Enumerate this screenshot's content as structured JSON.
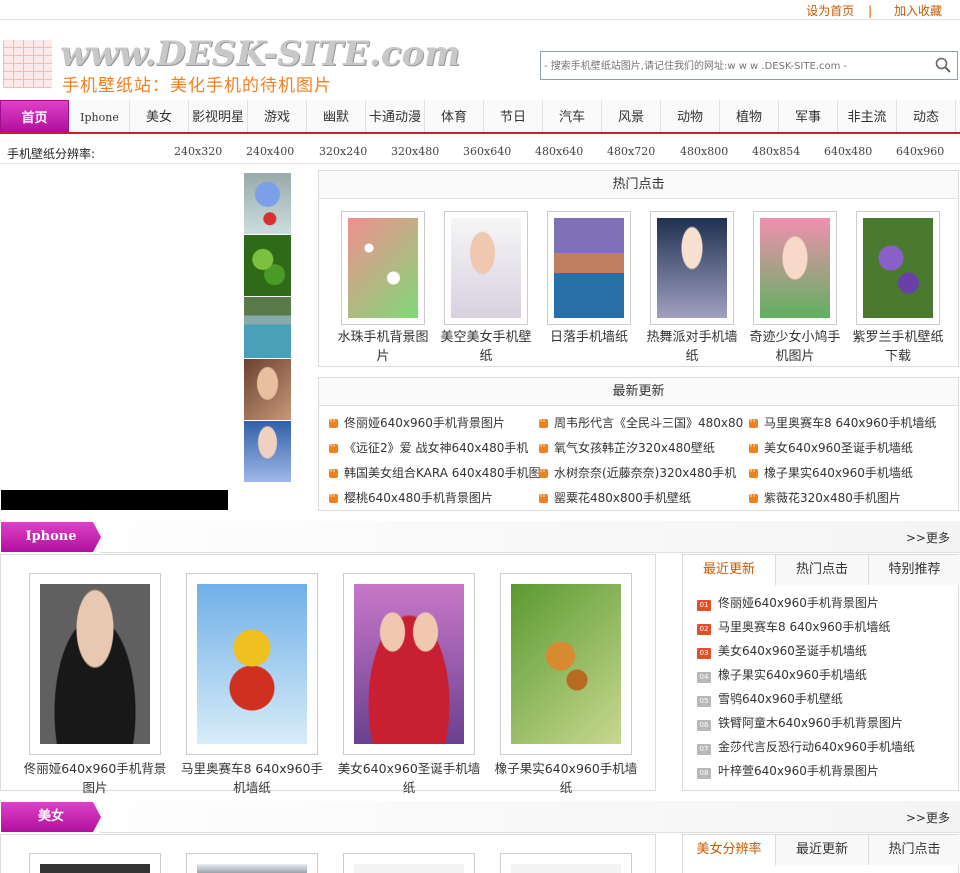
{
  "topbar": {
    "set_home": "设为首页",
    "separator": "|",
    "bookmark": "加入收藏"
  },
  "header": {
    "logo_text": "www.DESK-SITE.com",
    "logo_subtitle": "手机壁纸站：美化手机的待机图片",
    "search_placeholder": "- 搜索手机壁纸站图片,请记住我们的网址:w w w .DESK-SITE.com -"
  },
  "nav": [
    "首页",
    "Iphone",
    "美女",
    "影视明星",
    "游戏",
    "幽默",
    "卡通动漫",
    "体育",
    "节日",
    "汽车",
    "风景",
    "动物",
    "植物",
    "军事",
    "非主流",
    "动态"
  ],
  "resolution": {
    "label": "手机壁纸分辨率:",
    "items": [
      "240x320",
      "240x400",
      "320x240",
      "320x480",
      "360x640",
      "480x640",
      "480x720",
      "480x800",
      "480x854",
      "640x480",
      "640x960"
    ]
  },
  "hot": {
    "title": "热门点击",
    "items": [
      {
        "line1": "水珠手机背景图",
        "line2": "片"
      },
      {
        "line1": "美空美女手机壁",
        "line2": "纸"
      },
      {
        "line1": "日落手机墙纸",
        "line2": ""
      },
      {
        "line1": "热舞派对手机墙",
        "line2": "纸"
      },
      {
        "line1": "奇迹少女小鸠手",
        "line2": "机图片"
      },
      {
        "line1": "紫罗兰手机壁纸",
        "line2": "下载"
      }
    ]
  },
  "latest": {
    "title": "最新更新",
    "items": [
      "佟丽娅640x960手机背景图片",
      "周韦彤代言《全民斗三国》480x80",
      "马里奥赛车8 640x960手机墙纸",
      "《远征2》爱 战女神640x480手机",
      "氧气女孩韩芷汐320x480壁纸",
      "美女640x960圣诞手机墙纸",
      "韩国美女组合KARA 640x480手机图",
      "水树奈奈(近藤奈奈)320x480手机",
      "橡子果实640x960手机墙纸",
      "樱桃640x480手机背景图片",
      "罂粟花480x800手机壁纸",
      "紫薇花320x480手机图片"
    ]
  },
  "iphone_section": {
    "tag": "Iphone",
    "more": ">>更多",
    "gallery": [
      {
        "line1": "佟丽娅640x960手机背景",
        "line2": "图片"
      },
      {
        "line1": "马里奥赛车8 640x960手",
        "line2": "机墙纸"
      },
      {
        "line1": "美女640x960圣诞手机墙",
        "line2": "纸"
      },
      {
        "line1": "橡子果实640x960手机墙",
        "line2": "纸"
      }
    ],
    "tabs": [
      "最近更新",
      "热门点击",
      "特别推荐"
    ],
    "ranking": [
      {
        "num": "01",
        "text": "佟丽娅640x960手机背景图片"
      },
      {
        "num": "02",
        "text": "马里奥赛车8 640x960手机墙纸"
      },
      {
        "num": "03",
        "text": "美女640x960圣诞手机墙纸"
      },
      {
        "num": "04",
        "text": "橡子果实640x960手机墙纸"
      },
      {
        "num": "05",
        "text": "雪鸮640x960手机壁纸"
      },
      {
        "num": "06",
        "text": "铁臂阿童木640x960手机背景图片"
      },
      {
        "num": "07",
        "text": "金莎代言反恐行动640x960手机墙纸"
      },
      {
        "num": "08",
        "text": "叶梓萱640x960手机背景图片"
      }
    ]
  },
  "beauty_section": {
    "tag": "美女",
    "more": ">>更多",
    "tabs": [
      "美女分辨率",
      "最近更新",
      "热门点击"
    ]
  },
  "colors": {
    "accent": "#c8202a",
    "brand_pink": "#c0189c",
    "link_orange": "#c85a00"
  }
}
